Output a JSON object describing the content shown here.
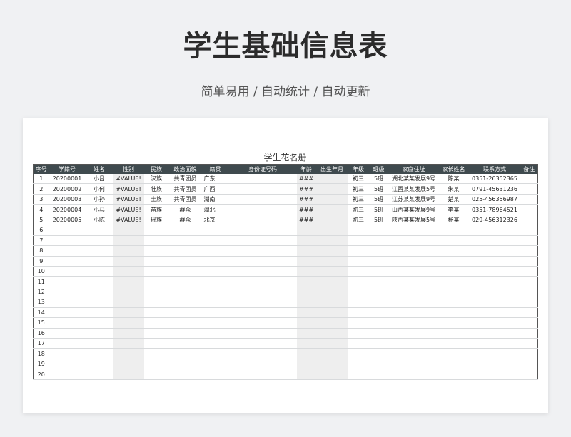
{
  "header": {
    "title": "学生基础信息表",
    "subtitle": "简单易用 / 自动统计 / 自动更新"
  },
  "sheet": {
    "title": "学生花名册",
    "columns": [
      "序号",
      "学籍号",
      "姓名",
      "性别",
      "民族",
      "政治面貌",
      "籍贯",
      "身份证号码",
      "年龄",
      "出生年月",
      "年级",
      "班级",
      "家庭住址",
      "家长姓名",
      "联系方式",
      "备注"
    ],
    "rows": [
      [
        "1",
        "20200001",
        "小吕",
        "#VALUE!",
        "汉族",
        "共青团员",
        "广东",
        "",
        "###",
        "",
        "初三",
        "5班",
        "湖北某某发展9号",
        "陈某",
        "0351-26352365",
        ""
      ],
      [
        "2",
        "20200002",
        "小何",
        "#VALUE!",
        "壮族",
        "共青团员",
        "广西",
        "",
        "###",
        "",
        "初三",
        "5班",
        "江西某某发展5号",
        "朱某",
        "0791-45631236",
        ""
      ],
      [
        "3",
        "20200003",
        "小孙",
        "#VALUE!",
        "土族",
        "共青团员",
        "湖南",
        "",
        "###",
        "",
        "初三",
        "5班",
        "江苏某某发展9号",
        "楚某",
        "025-456356987",
        ""
      ],
      [
        "4",
        "20200004",
        "小马",
        "#VALUE!",
        "苗族",
        "群众",
        "湖北",
        "",
        "###",
        "",
        "初三",
        "5班",
        "山西某某发展9号",
        "李某",
        "0351-78964521",
        ""
      ],
      [
        "5",
        "20200005",
        "小陈",
        "#VALUE!",
        "瑶族",
        "群众",
        "北京",
        "",
        "###",
        "",
        "初三",
        "5班",
        "陕西某某发展5号",
        "杨某",
        "029-456312326",
        ""
      ],
      [
        "6",
        "",
        "",
        "",
        "",
        "",
        "",
        "",
        "",
        "",
        "",
        "",
        "",
        "",
        "",
        ""
      ],
      [
        "7",
        "",
        "",
        "",
        "",
        "",
        "",
        "",
        "",
        "",
        "",
        "",
        "",
        "",
        "",
        ""
      ],
      [
        "8",
        "",
        "",
        "",
        "",
        "",
        "",
        "",
        "",
        "",
        "",
        "",
        "",
        "",
        "",
        ""
      ],
      [
        "9",
        "",
        "",
        "",
        "",
        "",
        "",
        "",
        "",
        "",
        "",
        "",
        "",
        "",
        "",
        ""
      ],
      [
        "10",
        "",
        "",
        "",
        "",
        "",
        "",
        "",
        "",
        "",
        "",
        "",
        "",
        "",
        "",
        ""
      ],
      [
        "11",
        "",
        "",
        "",
        "",
        "",
        "",
        "",
        "",
        "",
        "",
        "",
        "",
        "",
        "",
        ""
      ],
      [
        "12",
        "",
        "",
        "",
        "",
        "",
        "",
        "",
        "",
        "",
        "",
        "",
        "",
        "",
        "",
        ""
      ],
      [
        "13",
        "",
        "",
        "",
        "",
        "",
        "",
        "",
        "",
        "",
        "",
        "",
        "",
        "",
        "",
        ""
      ],
      [
        "14",
        "",
        "",
        "",
        "",
        "",
        "",
        "",
        "",
        "",
        "",
        "",
        "",
        "",
        "",
        ""
      ],
      [
        "15",
        "",
        "",
        "",
        "",
        "",
        "",
        "",
        "",
        "",
        "",
        "",
        "",
        "",
        "",
        ""
      ],
      [
        "16",
        "",
        "",
        "",
        "",
        "",
        "",
        "",
        "",
        "",
        "",
        "",
        "",
        "",
        "",
        ""
      ],
      [
        "17",
        "",
        "",
        "",
        "",
        "",
        "",
        "",
        "",
        "",
        "",
        "",
        "",
        "",
        "",
        ""
      ],
      [
        "18",
        "",
        "",
        "",
        "",
        "",
        "",
        "",
        "",
        "",
        "",
        "",
        "",
        "",
        "",
        ""
      ],
      [
        "19",
        "",
        "",
        "",
        "",
        "",
        "",
        "",
        "",
        "",
        "",
        "",
        "",
        "",
        "",
        ""
      ],
      [
        "20",
        "",
        "",
        "",
        "",
        "",
        "",
        "",
        "",
        "",
        "",
        "",
        "",
        "",
        "",
        ""
      ]
    ]
  }
}
